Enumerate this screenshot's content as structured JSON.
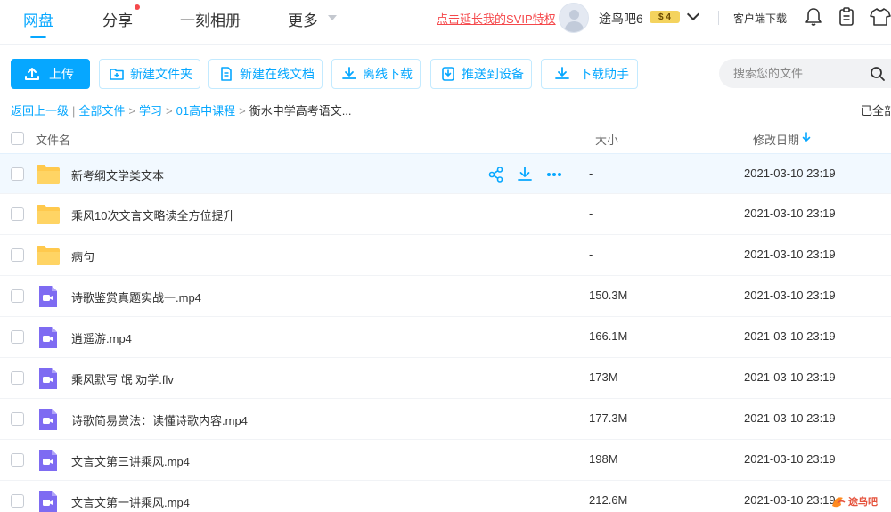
{
  "nav": {
    "tabs": [
      {
        "label": "网盘"
      },
      {
        "label": "分享"
      },
      {
        "label": "一刻相册"
      },
      {
        "label": "更多"
      }
    ],
    "svip_link": "点击延长我的SVIP特权",
    "username": "途鸟吧6",
    "vip_badge": "$ 4",
    "client_download": "客户端下载"
  },
  "toolbar": {
    "upload": "上传",
    "new_folder": "新建文件夹",
    "new_doc": "新建在线文档",
    "offline_download": "离线下载",
    "push_device": "推送到设备",
    "download_helper": "下载助手",
    "search_placeholder": "搜索您的文件"
  },
  "breadcrumb": {
    "back": "返回上一级",
    "items": [
      "全部文件",
      "学习",
      "01高中课程"
    ],
    "current": "衡水中学高考语文...",
    "loaded": "已全部"
  },
  "table": {
    "col_name": "文件名",
    "col_size": "大小",
    "col_date": "修改日期",
    "rows": [
      {
        "type": "folder",
        "name": "新考纲文学类文本",
        "size": "-",
        "date": "2021-03-10 23:19"
      },
      {
        "type": "folder",
        "name": "乘风10次文言文略读全方位提升",
        "size": "-",
        "date": "2021-03-10 23:19"
      },
      {
        "type": "folder",
        "name": "病句",
        "size": "-",
        "date": "2021-03-10 23:19"
      },
      {
        "type": "video",
        "name": "诗歌鉴赏真题实战一.mp4",
        "size": "150.3M",
        "date": "2021-03-10 23:19"
      },
      {
        "type": "video",
        "name": "逍遥游.mp4",
        "size": "166.1M",
        "date": "2021-03-10 23:19"
      },
      {
        "type": "video",
        "name": "乘风默写 氓 劝学.flv",
        "size": "173M",
        "date": "2021-03-10 23:19"
      },
      {
        "type": "video",
        "name": "诗歌简易赏法：读懂诗歌内容.mp4",
        "size": "177.3M",
        "date": "2021-03-10 23:19"
      },
      {
        "type": "video",
        "name": "文言文第三讲乘风.mp4",
        "size": "198M",
        "date": "2021-03-10 23:19"
      },
      {
        "type": "video",
        "name": "文言文第一讲乘风.mp4",
        "size": "212.6M",
        "date": "2021-03-10 23:19"
      }
    ]
  },
  "watermark": "途鸟吧",
  "colors": {
    "accent": "#06a7ff",
    "svip_red": "#f5484b",
    "folder": "#ffc94d",
    "video": "#7e6bf2"
  },
  "icons": [
    "bell-icon",
    "clipboard-icon",
    "shirt-icon",
    "search-icon",
    "share-icon",
    "download-icon",
    "more-icon",
    "folder-icon",
    "video-file-icon"
  ]
}
